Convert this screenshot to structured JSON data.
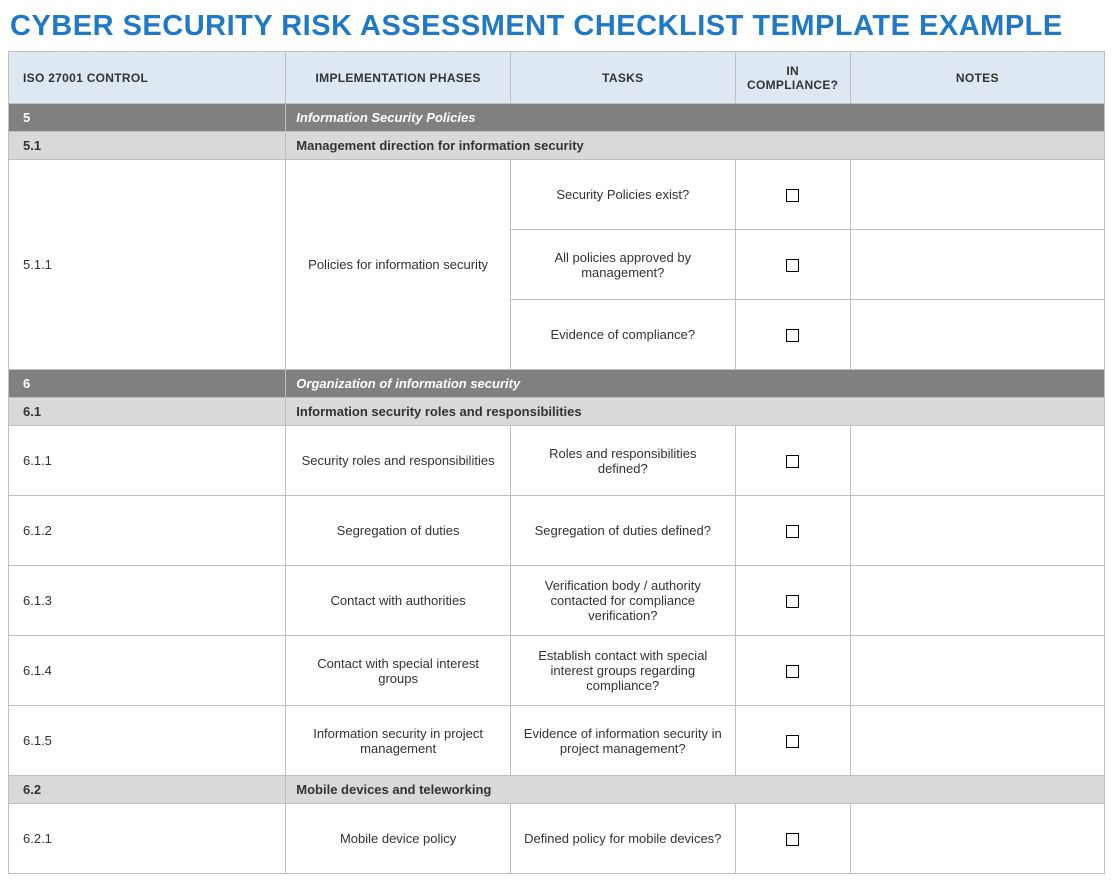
{
  "title": "CYBER SECURITY RISK ASSESSMENT CHECKLIST TEMPLATE EXAMPLE",
  "columns": {
    "c1": "ISO 27001 CONTROL",
    "c2": "IMPLEMENTATION PHASES",
    "c3": "TASKS",
    "c4": "IN COMPLIANCE?",
    "c5": "NOTES"
  },
  "rows": [
    {
      "type": "dark",
      "id": "5",
      "label": "Information Security Policies"
    },
    {
      "type": "light",
      "id": "5.1",
      "label": "Management direction for information security"
    },
    {
      "type": "data",
      "id": "5.1.1",
      "phase": "Policies for information security",
      "tasks": [
        "Security Policies exist?",
        "All policies approved by management?",
        "Evidence of compliance?"
      ]
    },
    {
      "type": "dark",
      "id": "6",
      "label": "Organization of information security"
    },
    {
      "type": "light",
      "id": "6.1",
      "label": "Information security roles and responsibilities"
    },
    {
      "type": "data",
      "id": "6.1.1",
      "phase": "Security roles and responsibilities",
      "tasks": [
        "Roles and responsibilities defined?"
      ]
    },
    {
      "type": "data",
      "id": "6.1.2",
      "phase": "Segregation of duties",
      "tasks": [
        "Segregation of duties defined?"
      ]
    },
    {
      "type": "data",
      "id": "6.1.3",
      "phase": "Contact with authorities",
      "tasks": [
        "Verification body / authority contacted for compliance verification?"
      ]
    },
    {
      "type": "data",
      "id": "6.1.4",
      "phase": "Contact with special interest groups",
      "tasks": [
        "Establish contact with special interest groups regarding compliance?"
      ]
    },
    {
      "type": "data",
      "id": "6.1.5",
      "phase": "Information security in project management",
      "tasks": [
        "Evidence of information security in project management?"
      ]
    },
    {
      "type": "light",
      "id": "6.2",
      "label": "Mobile devices and teleworking"
    },
    {
      "type": "data",
      "id": "6.2.1",
      "phase": "Mobile device policy",
      "tasks": [
        "Defined policy for mobile devices?"
      ]
    }
  ]
}
